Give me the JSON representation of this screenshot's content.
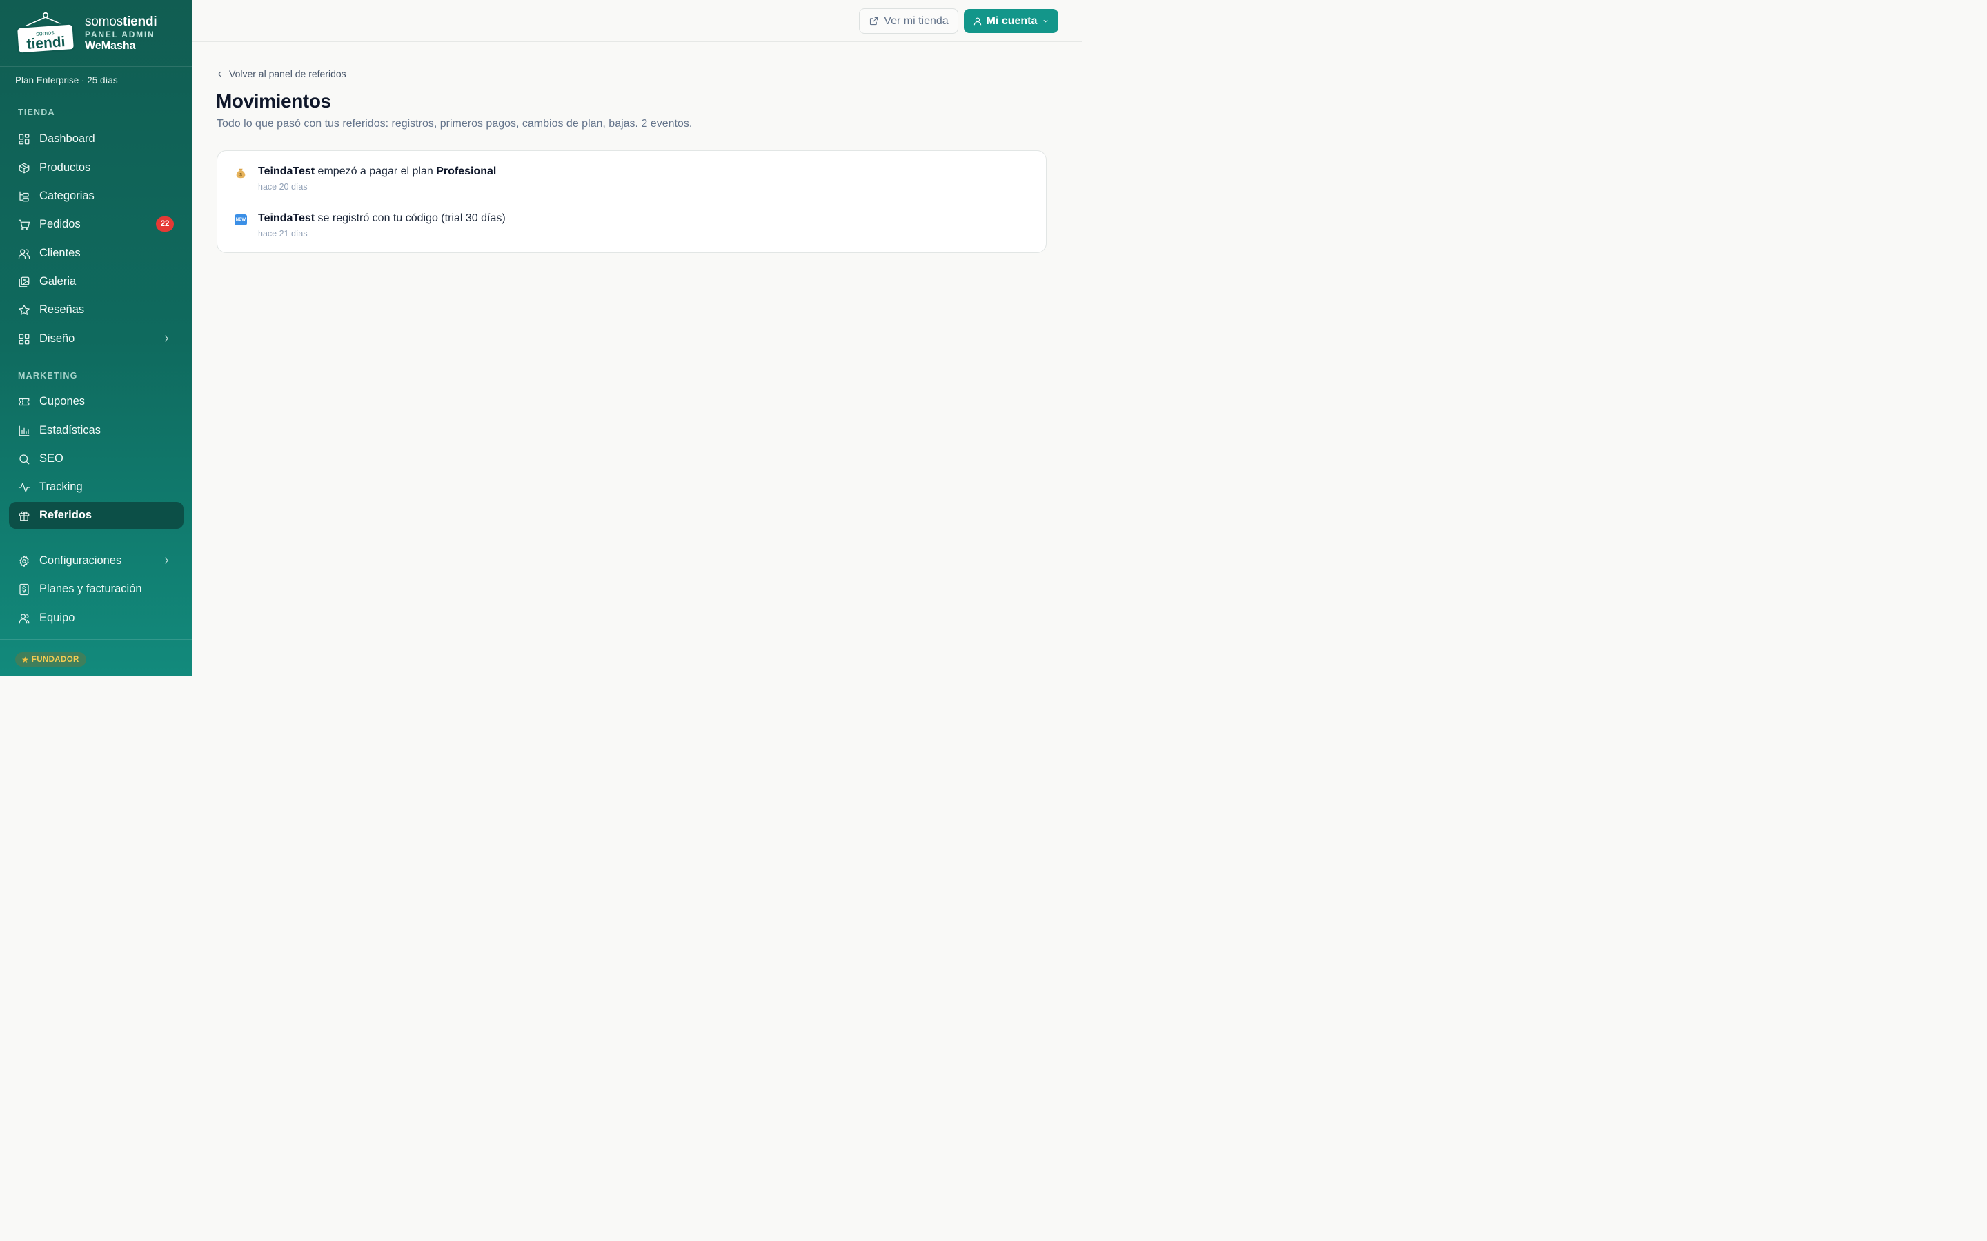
{
  "brand": {
    "name_prefix": "somos",
    "name_bold": "tiendi",
    "panel_label": "PANEL ADMIN",
    "store_name": "WeMasha",
    "logo_small": "somos",
    "logo_big": "tiendi"
  },
  "plan_line": "Plan Enterprise · 25 días",
  "sidebar": {
    "section_store": "TIENDA",
    "section_marketing": "MARKETING",
    "items": [
      {
        "label": "Dashboard",
        "icon": "dashboard-icon"
      },
      {
        "label": "Productos",
        "icon": "box-icon"
      },
      {
        "label": "Categorias",
        "icon": "category-tree-icon"
      },
      {
        "label": "Pedidos",
        "icon": "cart-icon",
        "badge": "22"
      },
      {
        "label": "Clientes",
        "icon": "users-icon"
      },
      {
        "label": "Galeria",
        "icon": "gallery-icon"
      },
      {
        "label": "Reseñas",
        "icon": "star-icon"
      },
      {
        "label": "Diseño",
        "icon": "layout-icon"
      },
      {
        "label": "Cupones",
        "icon": "ticket-icon"
      },
      {
        "label": "Estadísticas",
        "icon": "bar-chart-icon"
      },
      {
        "label": "SEO",
        "icon": "search-icon"
      },
      {
        "label": "Tracking",
        "icon": "activity-icon"
      },
      {
        "label": "Referidos",
        "icon": "gift-icon",
        "active": true
      },
      {
        "label": "Configuraciones",
        "icon": "gear-icon"
      },
      {
        "label": "Planes y facturación",
        "icon": "invoice-icon"
      },
      {
        "label": "Equipo",
        "icon": "team-icon"
      }
    ],
    "founder_badge": "FUNDADOR"
  },
  "topbar": {
    "store_button": "Ver mi tienda",
    "account_button": "Mi cuenta"
  },
  "main": {
    "back_link": "Volver al panel de referidos",
    "title": "Movimientos",
    "subtitle": "Todo lo que pasó con tus referidos: registros, primeros pagos, cambios de plan, bajas. 2 eventos.",
    "events": [
      {
        "icon": "money-bag",
        "store": "TeindaTest",
        "text": " empezó a pagar el plan ",
        "plan": "Profesional",
        "time": "hace 20 días"
      },
      {
        "icon": "new-badge",
        "icon_text": "NEW",
        "store": "TeindaTest",
        "text": " se registró con tu código (trial 30 días)",
        "time": "hace 21 días"
      }
    ]
  },
  "colors": {
    "sidebar_top": "#115d52",
    "sidebar_bottom": "#128a7c",
    "accent": "#13968a",
    "badge": "#e53935",
    "active_item": "#0c4f47"
  }
}
